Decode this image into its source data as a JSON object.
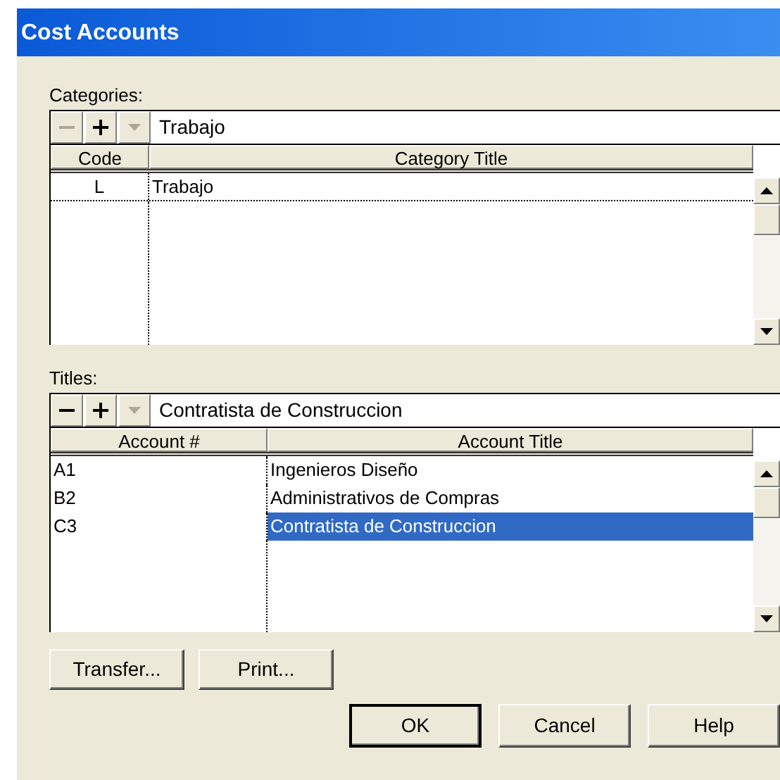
{
  "window": {
    "title": "Cost Accounts"
  },
  "sections": [
    {
      "label": "Categories:",
      "toolbar": {
        "remove_disabled": true,
        "add_disabled": false,
        "dropdown_disabled": true,
        "value": "Trabajo"
      },
      "columns": [
        "Code",
        "Category Title"
      ],
      "kind": "centered",
      "rows": [
        {
          "cells": [
            "L",
            "Trabajo"
          ],
          "selected": false
        }
      ]
    },
    {
      "label": "Titles:",
      "toolbar": {
        "remove_disabled": false,
        "add_disabled": false,
        "dropdown_disabled": true,
        "value": "Contratista de Construccion"
      },
      "columns": [
        "Account #",
        "Account Title"
      ],
      "kind": "plain",
      "rows": [
        {
          "cells": [
            "A1",
            "Ingenieros Diseño"
          ],
          "selected": false
        },
        {
          "cells": [
            "B2",
            "Administrativos de Compras"
          ],
          "selected": false
        },
        {
          "cells": [
            "C3",
            "Contratista de Construccion"
          ],
          "selected": true
        }
      ]
    }
  ],
  "actions": [
    "Transfer...",
    "Print..."
  ],
  "buttons": [
    {
      "label": "OK",
      "default": true
    },
    {
      "label": "Cancel",
      "default": false
    },
    {
      "label": "Help",
      "default": false
    }
  ]
}
